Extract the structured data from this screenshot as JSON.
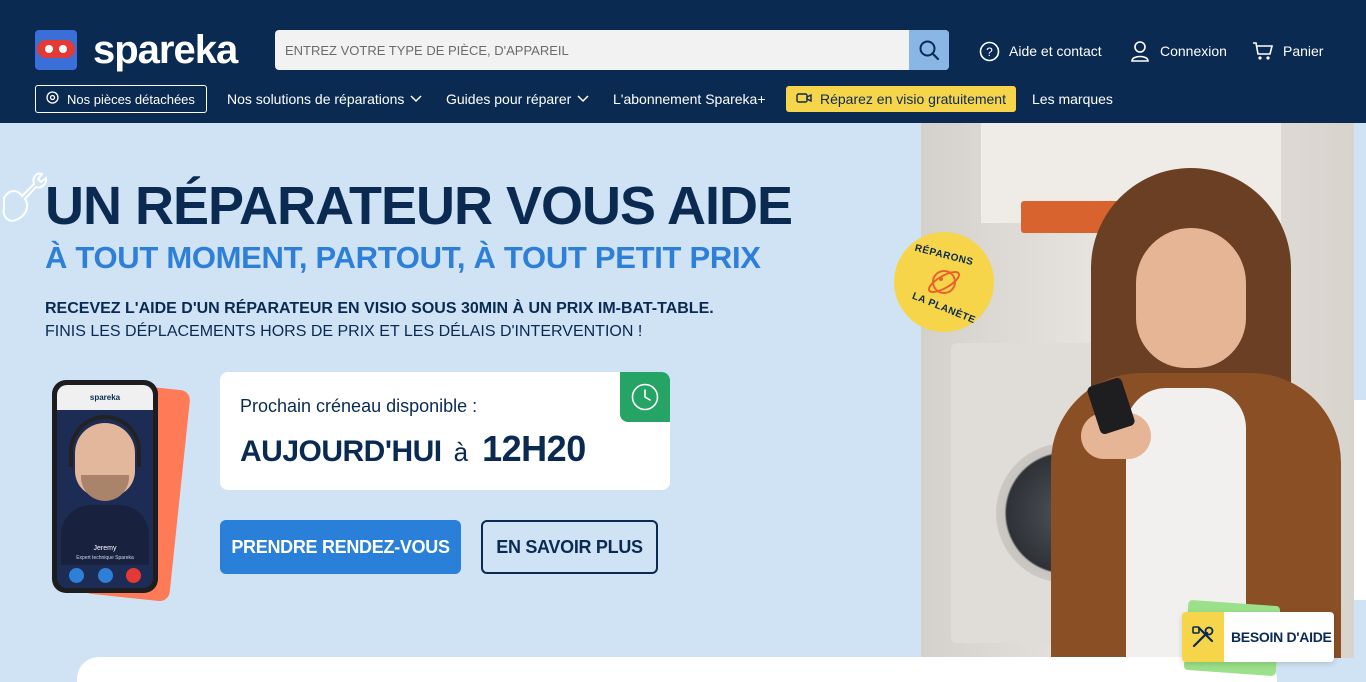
{
  "brand": {
    "name": "spareka"
  },
  "search": {
    "placeholder": "ENTREZ VOTRE TYPE DE PIÈCE, D'APPAREIL"
  },
  "header_links": {
    "help": "Aide et contact",
    "login": "Connexion",
    "cart": "Panier"
  },
  "nav": {
    "pieces": "Nos pièces détachées",
    "solutions": "Nos solutions de réparations",
    "guides": "Guides pour réparer",
    "subscription": "L'abonnement Spareka+",
    "visio": "Réparez en visio gratuitement",
    "brands": "Les marques"
  },
  "hero": {
    "title": "UN RÉPARATEUR VOUS AIDE",
    "subtitle": "À TOUT MOMENT, PARTOUT, À TOUT PETIT PRIX",
    "line1": "RECEVEZ L'AIDE D'UN RÉPARATEUR EN VISIO SOUS 30MIN À UN PRIX IM-BAT-TABLE.",
    "line2": "FINIS LES DÉPLACEMENTS HORS DE PRIX ET LES DÉLAIS D'INTERVENTION !"
  },
  "phone": {
    "app_name": "spareka",
    "person_name": "Jeremy",
    "person_role": "Expert technique Spareka"
  },
  "slot": {
    "label": "Prochain créneau disponible :",
    "day": "AUJOURD'HUI",
    "connector": "à",
    "time": "12H20"
  },
  "cta": {
    "primary": "PRENDRE RENDEZ-VOUS",
    "secondary": "EN SAVOIR PLUS"
  },
  "planet_badge": {
    "top": "RÉPARONS",
    "bottom": "LA PLANÈTE"
  },
  "help_widget": {
    "label": "BESOIN D'AIDE"
  },
  "colors": {
    "navy": "#0a2a52",
    "accent_blue": "#2a7fd9",
    "yellow": "#f7d54a",
    "green": "#26a465",
    "hero_bg": "#cfe3f5"
  }
}
